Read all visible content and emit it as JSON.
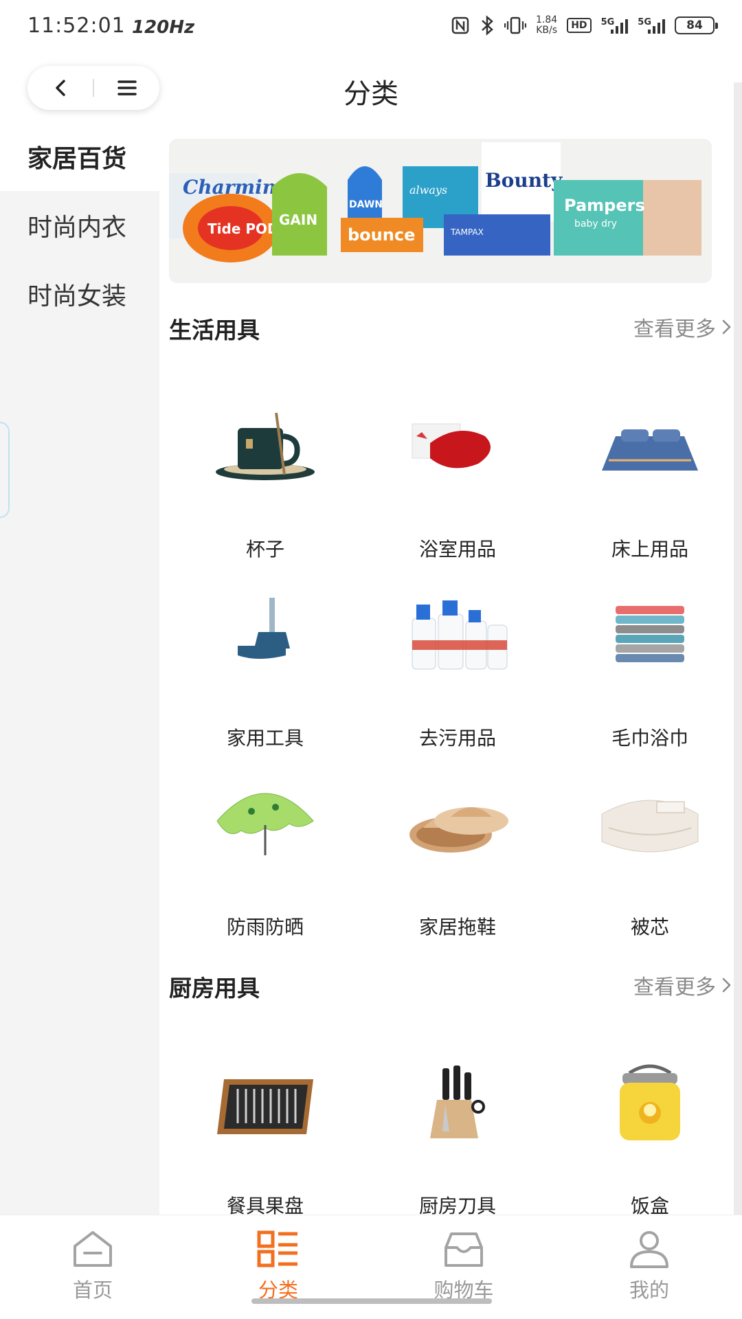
{
  "status_bar": {
    "time": "11:52:01",
    "refresh_rate": "120Hz",
    "net_speed_value": "1.84",
    "net_speed_unit": "KB/s",
    "hd_label": "HD",
    "signal_label_1": "5G",
    "signal_label_2": "5G",
    "battery": "84"
  },
  "header": {
    "title": "分类",
    "back_icon": "chevron-left-icon",
    "menu_icon": "hamburger-menu-icon"
  },
  "sidebar": {
    "items": [
      {
        "label": "家居百货",
        "active": true
      },
      {
        "label": "时尚内衣",
        "active": false
      },
      {
        "label": "时尚女装",
        "active": false
      }
    ]
  },
  "banner": {
    "brands": [
      "Charmin",
      "Tide PODS",
      "GAIN",
      "DAWN",
      "always",
      "bounce",
      "Bounty",
      "TAMPAX",
      "Pampers",
      "baby dry"
    ]
  },
  "sections": [
    {
      "title": "生活用具",
      "more_label": "查看更多",
      "items": [
        {
          "label": "杯子",
          "icon": "mug-icon"
        },
        {
          "label": "浴室用品",
          "icon": "soap-icon"
        },
        {
          "label": "床上用品",
          "icon": "bedding-icon"
        },
        {
          "label": "家用工具",
          "icon": "broom-dustpan-icon"
        },
        {
          "label": "去污用品",
          "icon": "spray-bottle-icon"
        },
        {
          "label": "毛巾浴巾",
          "icon": "towels-icon"
        },
        {
          "label": "防雨防晒",
          "icon": "umbrella-icon"
        },
        {
          "label": "家居拖鞋",
          "icon": "slippers-icon"
        },
        {
          "label": "被芯",
          "icon": "quilt-icon"
        }
      ]
    },
    {
      "title": "厨房用具",
      "more_label": "查看更多",
      "items": [
        {
          "label": "餐具果盘",
          "icon": "cutlery-case-icon"
        },
        {
          "label": "厨房刀具",
          "icon": "knife-block-icon"
        },
        {
          "label": "饭盒",
          "icon": "lunch-box-icon"
        }
      ]
    }
  ],
  "bottom_nav": {
    "items": [
      {
        "label": "首页",
        "icon": "home-icon",
        "active": false
      },
      {
        "label": "分类",
        "icon": "category-icon",
        "active": true
      },
      {
        "label": "购物车",
        "icon": "cart-box-icon",
        "active": false
      },
      {
        "label": "我的",
        "icon": "user-icon",
        "active": false
      }
    ]
  },
  "colors": {
    "accent": "#f36f20",
    "inactive": "#999999",
    "sidebar_bg": "#f4f4f4",
    "highlight": "#f6b56b"
  }
}
